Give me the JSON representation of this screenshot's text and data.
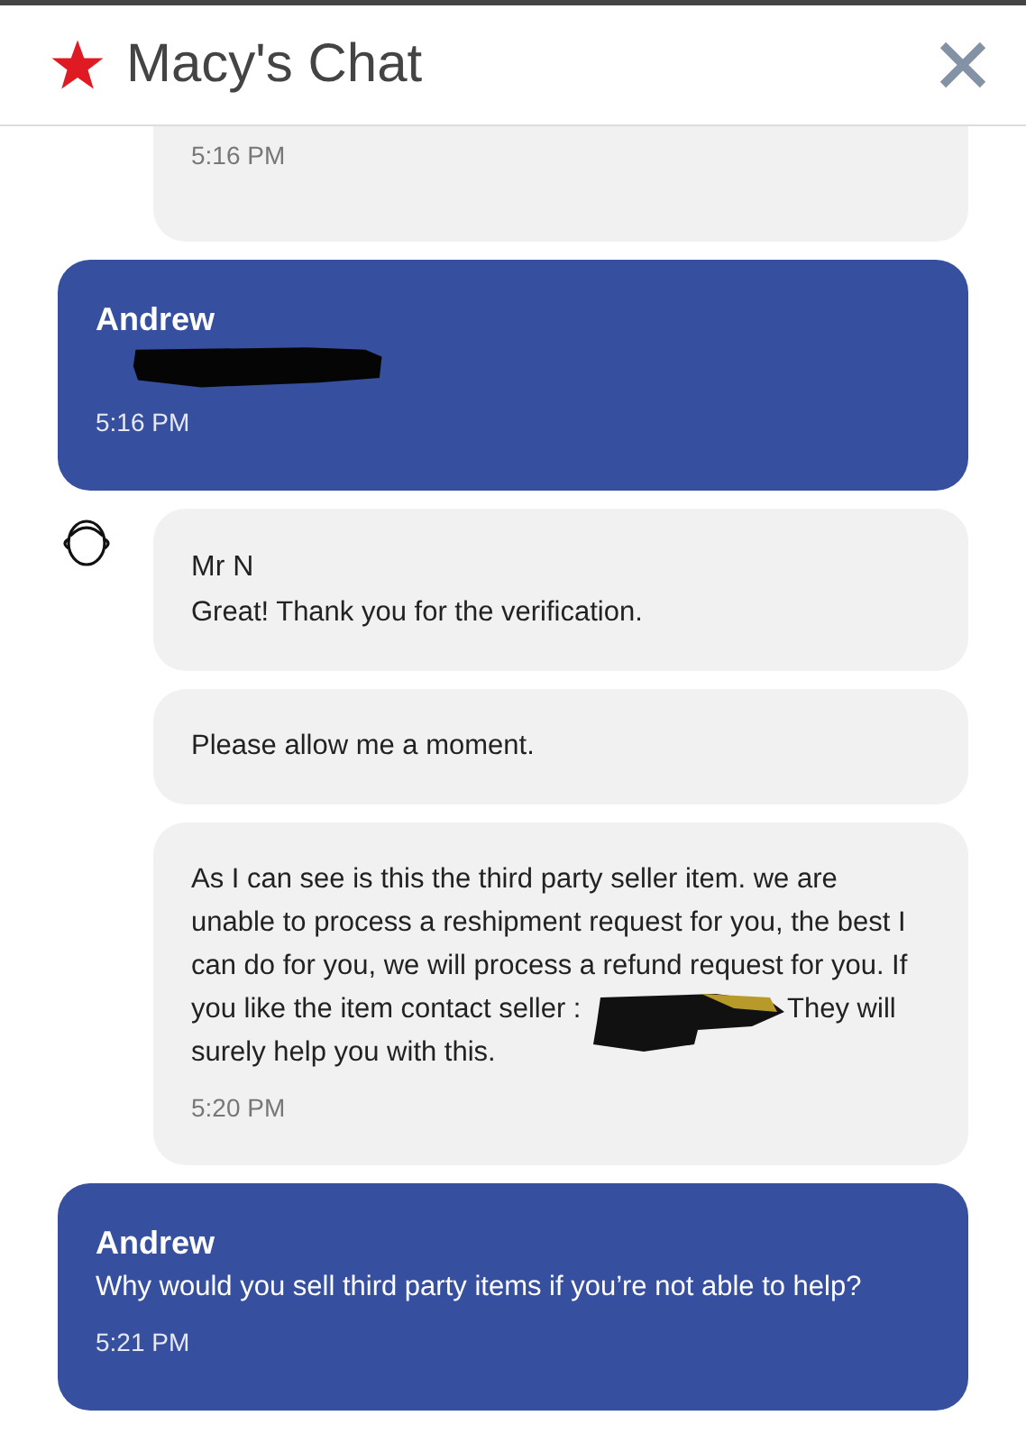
{
  "header": {
    "title": "Macy's Chat"
  },
  "messages": [
    {
      "kind": "agent",
      "avatar": false,
      "cut": true,
      "time": "5:16 PM"
    },
    {
      "kind": "user",
      "sender": "Andrew",
      "parts": [
        {
          "kind": "redaction"
        }
      ],
      "time": "5:16 PM"
    },
    {
      "kind": "agent",
      "avatar": true,
      "sender": "Mr N",
      "parts": [
        {
          "kind": "text",
          "text": "Great! Thank you for the verification."
        }
      ]
    },
    {
      "kind": "agent",
      "avatar": false,
      "parts": [
        {
          "kind": "text",
          "text": "Please allow me a moment."
        }
      ]
    },
    {
      "kind": "agent",
      "avatar": false,
      "parts": [
        {
          "kind": "text",
          "text": "As I can see is this the third party seller item. we are unable to process a reshipment request for you, the best I can do for you, we will process a refund request for you. If you like the item contact seller :"
        },
        {
          "kind": "redaction"
        },
        {
          "kind": "text",
          "text": "They will surely help you with this."
        }
      ],
      "time": "5:20 PM"
    },
    {
      "kind": "user",
      "sender": "Andrew",
      "parts": [
        {
          "kind": "text",
          "text": "Why would you sell third party items if you’re not able to help?"
        }
      ],
      "time": "5:21 PM"
    }
  ]
}
